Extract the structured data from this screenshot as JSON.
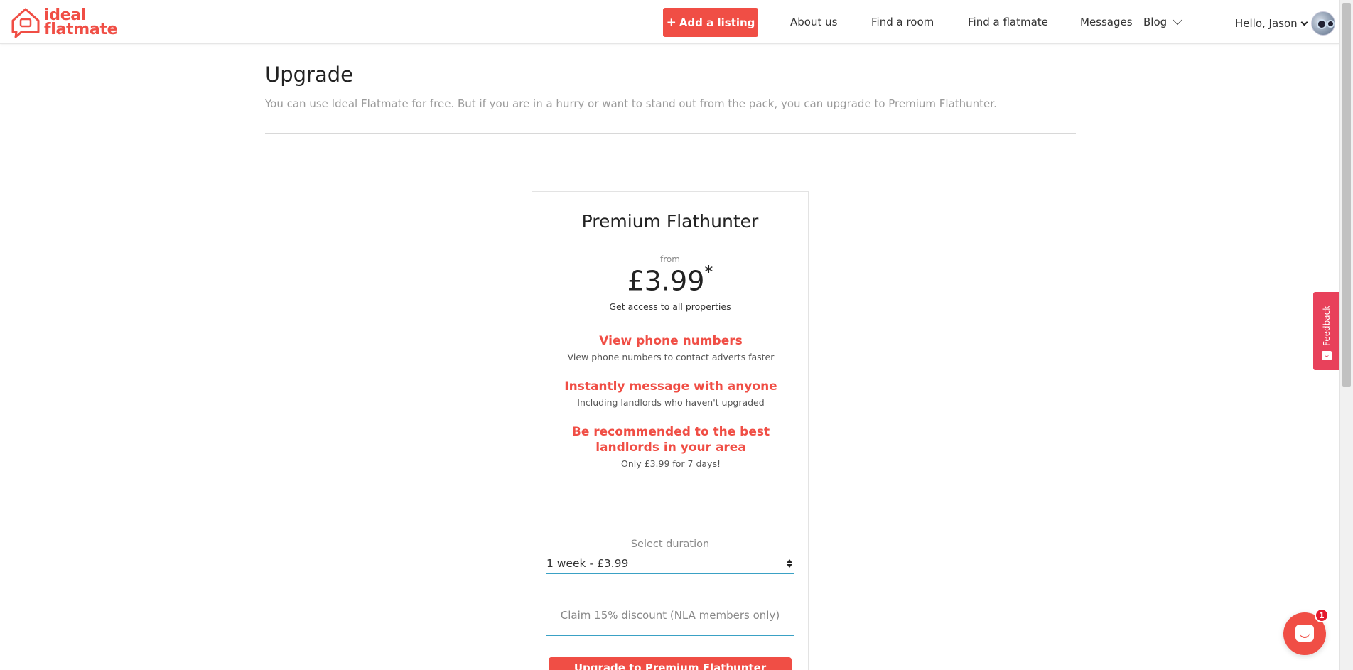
{
  "header": {
    "logo": {
      "line1": "ideal",
      "line2": "flatmate",
      "icon": "house-speech-icon"
    },
    "add_listing": {
      "icon": "plus-icon",
      "label": "Add a listing"
    },
    "nav": {
      "about": "About us",
      "find_room": "Find a room",
      "find_flatmate": "Find a flatmate",
      "messages": "Messages",
      "blog": "Blog"
    },
    "user": {
      "greeting": "Hello, Jason"
    }
  },
  "page": {
    "title": "Upgrade",
    "subtitle": "You can use Ideal Flatmate for free. But if you are in a hurry or want to stand out from the pack, you can upgrade to Premium Flathunter."
  },
  "plan": {
    "name": "Premium Flathunter",
    "from_label": "from",
    "price": "£3.99",
    "price_mark": "*",
    "tagline": "Get access to all properties",
    "features": [
      {
        "title": "View phone numbers",
        "desc": "View phone numbers to contact adverts faster"
      },
      {
        "title": "Instantly message with anyone",
        "desc": "Including landlords who haven't upgraded"
      },
      {
        "title": "Be recommended to the best landlords in your area",
        "desc": "Only £3.99 for 7 days!"
      }
    ],
    "duration_label": "Select duration",
    "duration_value": "1 week - £3.99",
    "discount_label": "Claim 15% discount (NLA members only)",
    "upgrade_button": "Upgrade to Premium Flathunter"
  },
  "widgets": {
    "feedback": "Feedback",
    "chat_badge": "1"
  },
  "colors": {
    "brand": "#f04e45",
    "focus_line": "#3aa1c5",
    "feedback": "#e8415b"
  }
}
